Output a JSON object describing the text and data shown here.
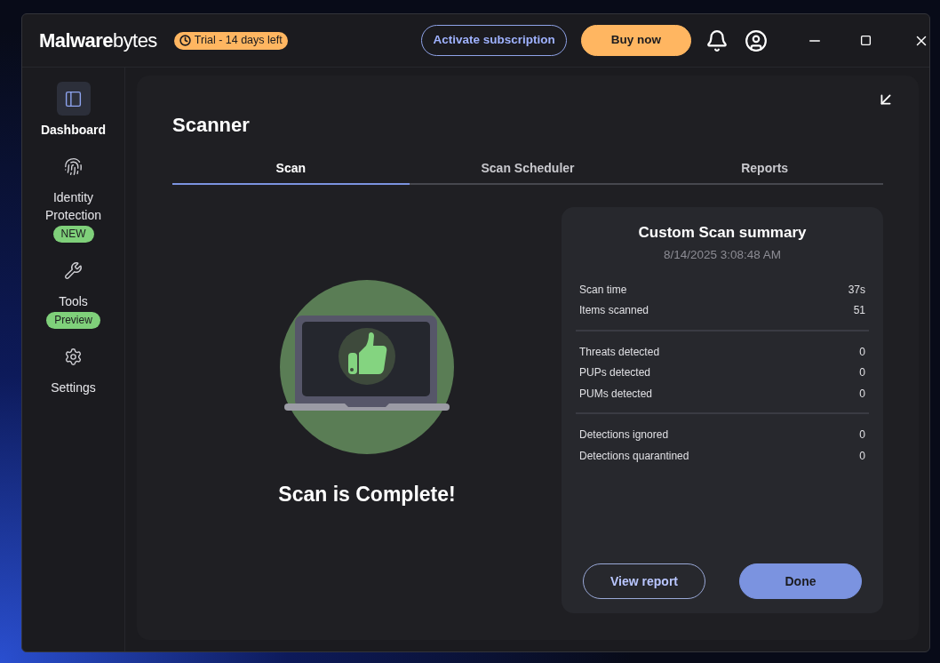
{
  "header": {
    "logo": "**Malware**bytes",
    "trial_badge": "Trial - 14 days left",
    "buttons": [
      {
        "label": "Activate subscription",
        "kind": "secondary"
      },
      {
        "label": "Buy now",
        "kind": "primary"
      }
    ]
  },
  "sidebar": {
    "items": [
      {
        "label": "Dashboard",
        "kind": "dashboard",
        "selected": true
      },
      {
        "label": "Identity Protection",
        "kind": "fingerprint",
        "selected": false,
        "badge": "NEW"
      },
      {
        "label": "Tools",
        "kind": "wrench",
        "selected": false,
        "badge": "Preview"
      },
      {
        "label": "Settings",
        "kind": "settings",
        "selected": false
      }
    ]
  },
  "page": {
    "title": "Scanner",
    "tabs": [
      {
        "label": "Scan",
        "selected": true
      },
      {
        "label": "Scan Scheduler",
        "selected": false
      },
      {
        "label": "Reports",
        "selected": false
      }
    ],
    "status": "Scan is Complete!"
  },
  "summary": {
    "title": "Custom Scan summary",
    "timestamp": "8/14/2025 3:08:48 AM",
    "groups": [
      [
        {
          "label": "Scan time",
          "value": "37s"
        },
        {
          "label": "Items scanned",
          "value": "51"
        }
      ],
      [
        {
          "label": "Threats detected",
          "value": "0"
        },
        {
          "label": "PUPs detected",
          "value": "0"
        },
        {
          "label": "PUMs detected",
          "value": "0"
        }
      ],
      [
        {
          "label": "Detections ignored",
          "value": "0"
        },
        {
          "label": "Detections quarantined",
          "value": "0"
        }
      ]
    ],
    "buttons": [
      {
        "label": "View report",
        "kind": "secondary"
      },
      {
        "label": "Done",
        "kind": "primary"
      }
    ]
  }
}
